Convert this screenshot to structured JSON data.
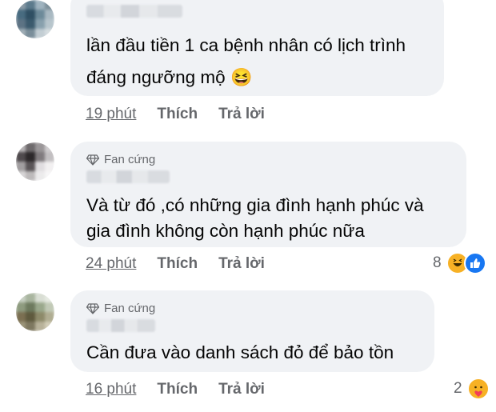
{
  "comments": [
    {
      "text_lines": [
        "lần đầu tiền 1 ca bệnh nhân có lịch trình",
        "đáng ngưỡng mộ"
      ],
      "emoji": "😆",
      "time": "19 phút",
      "like_label": "Thích",
      "reply_label": "Trả lời"
    },
    {
      "badge": "Fan cứng",
      "text_lines": [
        "Và từ đó ,có những gia đình hạnh phúc và",
        "gia đình không còn hạnh phúc nữa"
      ],
      "time": "24 phút",
      "like_label": "Thích",
      "reply_label": "Trả lời",
      "reaction_count": "8",
      "reaction_icons": [
        "haha-icon",
        "like-icon"
      ]
    },
    {
      "badge": "Fan cứng",
      "text_lines": [
        "Cần đưa vào danh sách đỏ để bảo tồn"
      ],
      "time": "16 phút",
      "like_label": "Thích",
      "reply_label": "Trả lời",
      "reaction_count": "2",
      "reaction_icons": [
        "care-icon"
      ]
    }
  ],
  "colors": {
    "bubble": "#f0f2f5",
    "meta": "#65676b",
    "text": "#050505",
    "like_blue": "#1877f2",
    "haha_yellow": "#f7b125"
  }
}
